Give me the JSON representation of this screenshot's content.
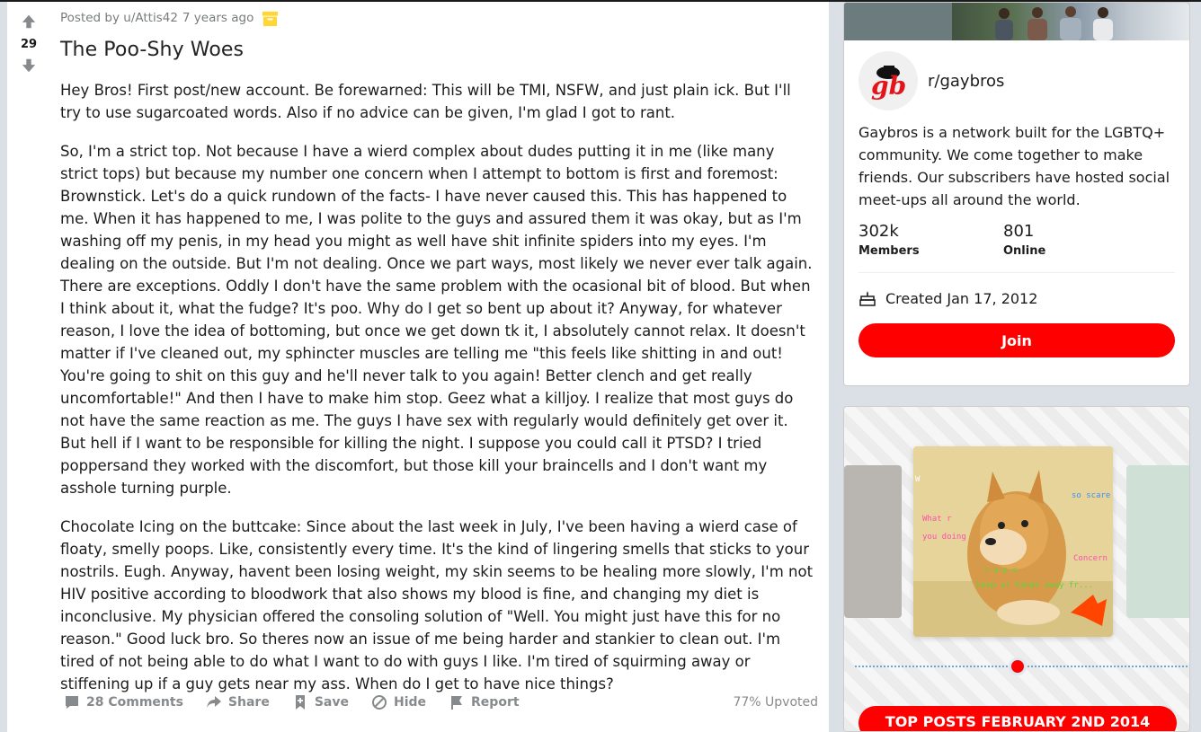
{
  "post": {
    "score": "29",
    "posted_by": "Posted by u/Attis42",
    "time": "7 years ago",
    "title": "The Poo-Shy Woes",
    "paragraphs": [
      "Hey Bros! First post/new account. Be forewarned: This will be TMI, NSFW, and just plain ick. But I'll try to use sugarcoated words. Also if no advice can be given, I'm glad I got to rant.",
      "So, I'm a strict top. Not because I have a wierd complex about dudes putting it in me (like many strict tops) but because my number one concern when I attempt to bottom is first and foremost: Brownstick. Let's do a quick rundown of the facts- I have never caused this. This has happened to me. When it has happened to me, I was polite to the guys and assured them it was okay, but as I'm washing off my penis, in my head you might as well have shit infinite spiders into my eyes. I'm dealing on the outside. But I'm not dealing. Once we part ways, most likely we never ever talk again. There are exceptions. Oddly I don't have the same problem with the ocasional bit of blood. But when I think about it, what the fudge? It's poo. Why do I get so bent up about it? Anyway, for whatever reason, I love the idea of bottoming, but once we get down tk it, I absolutely cannot relax. It doesn't matter if I've cleaned out, my sphincter muscles are telling me \"this feels like shitting in and out! You're going to shit on this guy and he'll never talk to you again! Better clench and get really uncomfortable!\" And then I have to make him stop. Geez what a killjoy. I realize that most guys do not have the same reaction as me. The guys I have sex with regularly would definitely get over it. But hell if I want to be responsible for killing the night. I suppose you could call it PTSD? I tried poppersand they worked with the discomfort, but those kill your braincells and I don't want my asshole turning purple.",
      "Chocolate Icing on the buttcake: Since about the last week in July, I've been having a wierd case of floaty, smelly poops. Like, consistently every time. It's the kind of lingering smells that sticks to your nostrils. Eugh. Anyway, havent been losing weight, my skin seems to be healing more slowly, I'm not HIV positive according to bloodwork that also shows my blood is fine, and changing my diet is inconclusive. My physician offered the consoling solution of \"Well. You might just have this for no reason.\" Good luck bro. So theres now an issue of me being harder and stankier to clean out. I'm tired of not being able to do what I want to do with guys I like. I'm tired of squirming away or stiffening up if a guy gets near my ass. When do I get to have nice things?"
    ],
    "actions": {
      "comments": "28 Comments",
      "share": "Share",
      "save": "Save",
      "hide": "Hide",
      "report": "Report"
    },
    "upvoted": "77% Upvoted"
  },
  "community": {
    "name": "r/gaybros",
    "logo_text": "gb",
    "description": "Gaybros is a network built for the LGBTQ+ community. We come together to make friends. Our subscribers have hosted social meet-ups all around the world.",
    "members_count": "302k",
    "members_label": "Members",
    "online_count": "801",
    "online_label": "Online",
    "created": "Created Jan 17, 2012",
    "join_label": "Join"
  },
  "promo": {
    "button_label": "TOP POSTS FEBRUARY 2ND 2014",
    "doge_phrases": [
      "W",
      "What r",
      "you doing",
      "so scare",
      "Concern",
      "r-a-p-e",
      "keep ur hands away fr..."
    ]
  },
  "colors": {
    "accent": "#ff0000",
    "meta_gray": "#787c7e",
    "action_gray": "#878a8c"
  }
}
